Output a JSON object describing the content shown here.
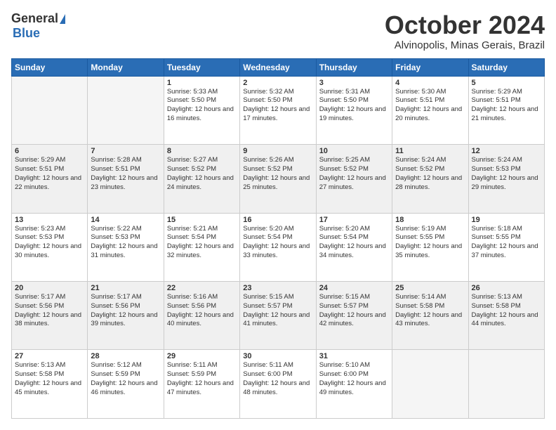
{
  "header": {
    "logo_general": "General",
    "logo_blue": "Blue",
    "month_title": "October 2024",
    "location": "Alvinopolis, Minas Gerais, Brazil"
  },
  "days_of_week": [
    "Sunday",
    "Monday",
    "Tuesday",
    "Wednesday",
    "Thursday",
    "Friday",
    "Saturday"
  ],
  "weeks": [
    [
      {
        "day": "",
        "sunrise": "",
        "sunset": "",
        "daylight": "",
        "empty": true
      },
      {
        "day": "",
        "sunrise": "",
        "sunset": "",
        "daylight": "",
        "empty": true
      },
      {
        "day": "1",
        "sunrise": "Sunrise: 5:33 AM",
        "sunset": "Sunset: 5:50 PM",
        "daylight": "Daylight: 12 hours and 16 minutes.",
        "empty": false
      },
      {
        "day": "2",
        "sunrise": "Sunrise: 5:32 AM",
        "sunset": "Sunset: 5:50 PM",
        "daylight": "Daylight: 12 hours and 17 minutes.",
        "empty": false
      },
      {
        "day": "3",
        "sunrise": "Sunrise: 5:31 AM",
        "sunset": "Sunset: 5:50 PM",
        "daylight": "Daylight: 12 hours and 19 minutes.",
        "empty": false
      },
      {
        "day": "4",
        "sunrise": "Sunrise: 5:30 AM",
        "sunset": "Sunset: 5:51 PM",
        "daylight": "Daylight: 12 hours and 20 minutes.",
        "empty": false
      },
      {
        "day": "5",
        "sunrise": "Sunrise: 5:29 AM",
        "sunset": "Sunset: 5:51 PM",
        "daylight": "Daylight: 12 hours and 21 minutes.",
        "empty": false
      }
    ],
    [
      {
        "day": "6",
        "sunrise": "Sunrise: 5:29 AM",
        "sunset": "Sunset: 5:51 PM",
        "daylight": "Daylight: 12 hours and 22 minutes.",
        "empty": false
      },
      {
        "day": "7",
        "sunrise": "Sunrise: 5:28 AM",
        "sunset": "Sunset: 5:51 PM",
        "daylight": "Daylight: 12 hours and 23 minutes.",
        "empty": false
      },
      {
        "day": "8",
        "sunrise": "Sunrise: 5:27 AM",
        "sunset": "Sunset: 5:52 PM",
        "daylight": "Daylight: 12 hours and 24 minutes.",
        "empty": false
      },
      {
        "day": "9",
        "sunrise": "Sunrise: 5:26 AM",
        "sunset": "Sunset: 5:52 PM",
        "daylight": "Daylight: 12 hours and 25 minutes.",
        "empty": false
      },
      {
        "day": "10",
        "sunrise": "Sunrise: 5:25 AM",
        "sunset": "Sunset: 5:52 PM",
        "daylight": "Daylight: 12 hours and 27 minutes.",
        "empty": false
      },
      {
        "day": "11",
        "sunrise": "Sunrise: 5:24 AM",
        "sunset": "Sunset: 5:52 PM",
        "daylight": "Daylight: 12 hours and 28 minutes.",
        "empty": false
      },
      {
        "day": "12",
        "sunrise": "Sunrise: 5:24 AM",
        "sunset": "Sunset: 5:53 PM",
        "daylight": "Daylight: 12 hours and 29 minutes.",
        "empty": false
      }
    ],
    [
      {
        "day": "13",
        "sunrise": "Sunrise: 5:23 AM",
        "sunset": "Sunset: 5:53 PM",
        "daylight": "Daylight: 12 hours and 30 minutes.",
        "empty": false
      },
      {
        "day": "14",
        "sunrise": "Sunrise: 5:22 AM",
        "sunset": "Sunset: 5:53 PM",
        "daylight": "Daylight: 12 hours and 31 minutes.",
        "empty": false
      },
      {
        "day": "15",
        "sunrise": "Sunrise: 5:21 AM",
        "sunset": "Sunset: 5:54 PM",
        "daylight": "Daylight: 12 hours and 32 minutes.",
        "empty": false
      },
      {
        "day": "16",
        "sunrise": "Sunrise: 5:20 AM",
        "sunset": "Sunset: 5:54 PM",
        "daylight": "Daylight: 12 hours and 33 minutes.",
        "empty": false
      },
      {
        "day": "17",
        "sunrise": "Sunrise: 5:20 AM",
        "sunset": "Sunset: 5:54 PM",
        "daylight": "Daylight: 12 hours and 34 minutes.",
        "empty": false
      },
      {
        "day": "18",
        "sunrise": "Sunrise: 5:19 AM",
        "sunset": "Sunset: 5:55 PM",
        "daylight": "Daylight: 12 hours and 35 minutes.",
        "empty": false
      },
      {
        "day": "19",
        "sunrise": "Sunrise: 5:18 AM",
        "sunset": "Sunset: 5:55 PM",
        "daylight": "Daylight: 12 hours and 37 minutes.",
        "empty": false
      }
    ],
    [
      {
        "day": "20",
        "sunrise": "Sunrise: 5:17 AM",
        "sunset": "Sunset: 5:56 PM",
        "daylight": "Daylight: 12 hours and 38 minutes.",
        "empty": false
      },
      {
        "day": "21",
        "sunrise": "Sunrise: 5:17 AM",
        "sunset": "Sunset: 5:56 PM",
        "daylight": "Daylight: 12 hours and 39 minutes.",
        "empty": false
      },
      {
        "day": "22",
        "sunrise": "Sunrise: 5:16 AM",
        "sunset": "Sunset: 5:56 PM",
        "daylight": "Daylight: 12 hours and 40 minutes.",
        "empty": false
      },
      {
        "day": "23",
        "sunrise": "Sunrise: 5:15 AM",
        "sunset": "Sunset: 5:57 PM",
        "daylight": "Daylight: 12 hours and 41 minutes.",
        "empty": false
      },
      {
        "day": "24",
        "sunrise": "Sunrise: 5:15 AM",
        "sunset": "Sunset: 5:57 PM",
        "daylight": "Daylight: 12 hours and 42 minutes.",
        "empty": false
      },
      {
        "day": "25",
        "sunrise": "Sunrise: 5:14 AM",
        "sunset": "Sunset: 5:58 PM",
        "daylight": "Daylight: 12 hours and 43 minutes.",
        "empty": false
      },
      {
        "day": "26",
        "sunrise": "Sunrise: 5:13 AM",
        "sunset": "Sunset: 5:58 PM",
        "daylight": "Daylight: 12 hours and 44 minutes.",
        "empty": false
      }
    ],
    [
      {
        "day": "27",
        "sunrise": "Sunrise: 5:13 AM",
        "sunset": "Sunset: 5:58 PM",
        "daylight": "Daylight: 12 hours and 45 minutes.",
        "empty": false
      },
      {
        "day": "28",
        "sunrise": "Sunrise: 5:12 AM",
        "sunset": "Sunset: 5:59 PM",
        "daylight": "Daylight: 12 hours and 46 minutes.",
        "empty": false
      },
      {
        "day": "29",
        "sunrise": "Sunrise: 5:11 AM",
        "sunset": "Sunset: 5:59 PM",
        "daylight": "Daylight: 12 hours and 47 minutes.",
        "empty": false
      },
      {
        "day": "30",
        "sunrise": "Sunrise: 5:11 AM",
        "sunset": "Sunset: 6:00 PM",
        "daylight": "Daylight: 12 hours and 48 minutes.",
        "empty": false
      },
      {
        "day": "31",
        "sunrise": "Sunrise: 5:10 AM",
        "sunset": "Sunset: 6:00 PM",
        "daylight": "Daylight: 12 hours and 49 minutes.",
        "empty": false
      },
      {
        "day": "",
        "sunrise": "",
        "sunset": "",
        "daylight": "",
        "empty": true
      },
      {
        "day": "",
        "sunrise": "",
        "sunset": "",
        "daylight": "",
        "empty": true
      }
    ]
  ]
}
